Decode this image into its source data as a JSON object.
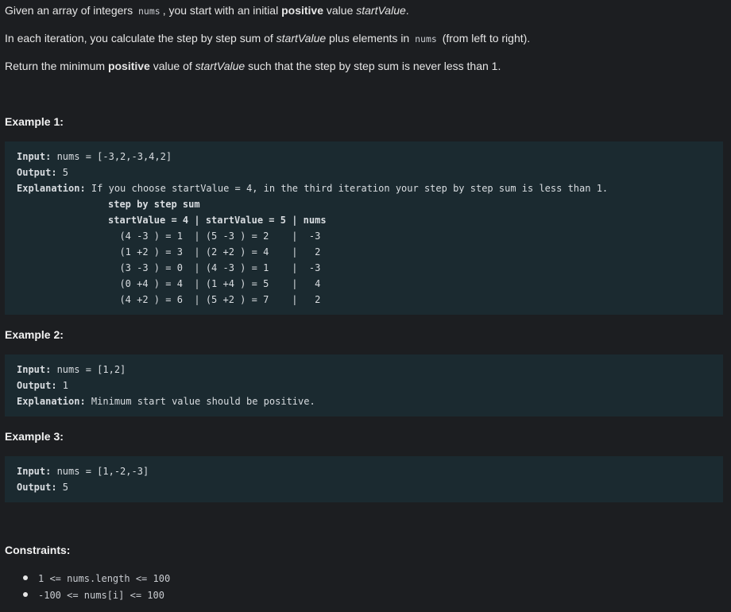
{
  "description": {
    "p1": {
      "t1": "Given an array of integers ",
      "code": "nums",
      "t2": ", you start with an initial ",
      "bold": "positive",
      "t3": " value ",
      "em": "startValue",
      "t4": "."
    },
    "p2": {
      "t1": "In each iteration, you calculate the step by step sum of ",
      "em": "startValue",
      "t2": " plus elements in ",
      "code": "nums",
      "t3": " (from left to right)."
    },
    "p3": {
      "t1": "Return the minimum ",
      "bold": "positive",
      "t2": " value of ",
      "em": "startValue",
      "t3": " such that the step by step sum is never less than 1."
    }
  },
  "examples": [
    {
      "title": "Example 1:",
      "input_label": "Input:",
      "input_value": " nums = [-3,2,-3,4,2]",
      "output_label": "Output:",
      "output_value": " 5",
      "explanation_label": "Explanation:",
      "explanation_value": " If you choose startValue = 4, in the third iteration your step by step sum is less than 1.",
      "table_title": "step by step sum",
      "table_header_1": "startValue = 4 ",
      "table_header_2": "| startValue = 5 ",
      "table_header_3": "| nums",
      "table_rows": [
        "  (4 -3 ) = 1  | (5 -3 ) = 2    |  -3",
        "  (1 +2 ) = 3  | (2 +2 ) = 4    |   2",
        "  (3 -3 ) = 0  | (4 -3 ) = 1    |  -3",
        "  (0 +4 ) = 4  | (1 +4 ) = 5    |   4",
        "  (4 +2 ) = 6  | (5 +2 ) = 7    |   2"
      ]
    },
    {
      "title": "Example 2:",
      "input_label": "Input:",
      "input_value": " nums = [1,2]",
      "output_label": "Output:",
      "output_value": " 1",
      "explanation_label": "Explanation:",
      "explanation_value": " Minimum start value should be positive."
    },
    {
      "title": "Example 3:",
      "input_label": "Input:",
      "input_value": " nums = [1,-2,-3]",
      "output_label": "Output:",
      "output_value": " 5"
    }
  ],
  "constraints": {
    "title": "Constraints:",
    "items": [
      "1 <= nums.length <= 100",
      "-100 <= nums[i] <= 100"
    ]
  }
}
